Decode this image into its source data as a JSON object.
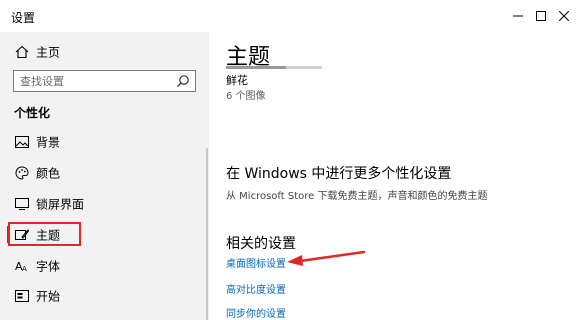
{
  "window": {
    "title": "设置",
    "controls": {
      "minimize": "minimize-icon",
      "maximize": "maximize-icon",
      "close": "close-icon"
    }
  },
  "sidebar": {
    "home_label": "主页",
    "search_placeholder": "查找设置",
    "section_title": "个性化",
    "items": [
      {
        "label": "背景",
        "icon": "image-icon"
      },
      {
        "label": "颜色",
        "icon": "palette-icon"
      },
      {
        "label": "锁屏界面",
        "icon": "lock-screen-icon"
      },
      {
        "label": "主题",
        "icon": "theme-icon",
        "active": true
      },
      {
        "label": "字体",
        "icon": "font-icon"
      },
      {
        "label": "开始",
        "icon": "start-icon"
      }
    ]
  },
  "main": {
    "title": "主题",
    "current_theme": {
      "name": "鲜花",
      "count": "6 个图像"
    },
    "store_section": {
      "heading": "在 Windows 中进行更多个性化设置",
      "description": "从 Microsoft Store 下载免费主题，声音和颜色的免费主题"
    },
    "related_section": {
      "heading": "相关的设置",
      "links": [
        "桌面图标设置",
        "高对比度设置",
        "同步你的设置"
      ]
    }
  },
  "colors": {
    "accent": "#0067c0",
    "sidebar_bg": "#f2f2f2",
    "annotation_red": "#e02828"
  }
}
